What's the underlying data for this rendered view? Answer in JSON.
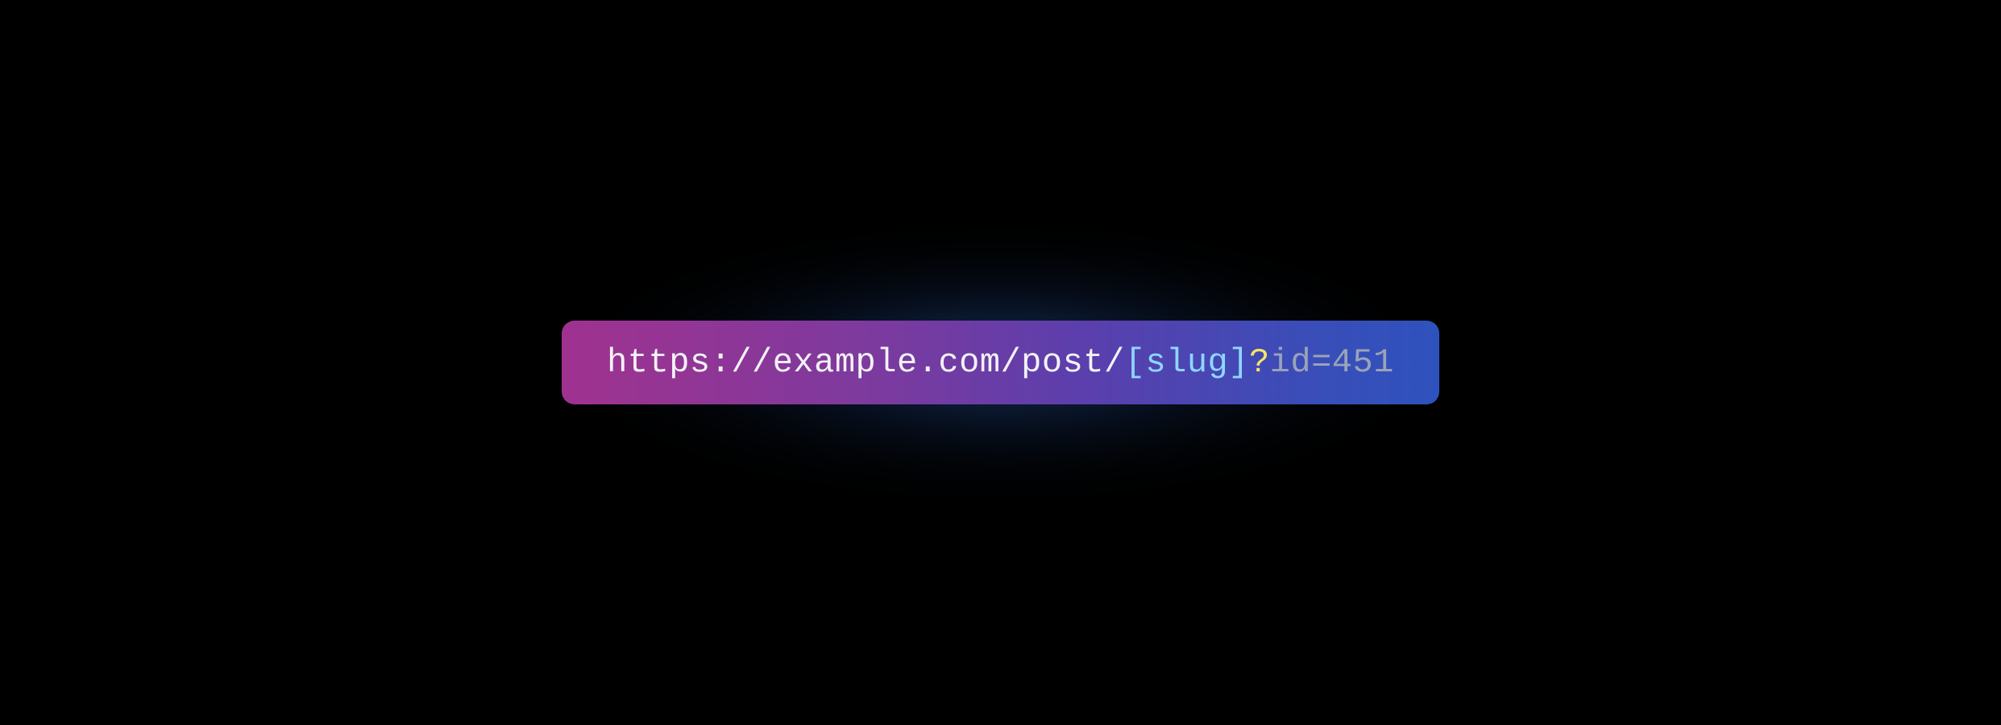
{
  "url": {
    "base": "https://example.com/post/",
    "slug": "[slug]",
    "question_mark": "?",
    "query": "id=451"
  },
  "colors": {
    "background": "#000000",
    "bar_gradient_start": "#a0328f",
    "bar_gradient_end": "#2e52bd",
    "text_base": "#f2f2f5",
    "text_slug": "#8fd6ff",
    "text_qmark": "#f5e663",
    "text_query": "#9aa3b8",
    "glow": "rgba(40,90,160,0.55)"
  }
}
